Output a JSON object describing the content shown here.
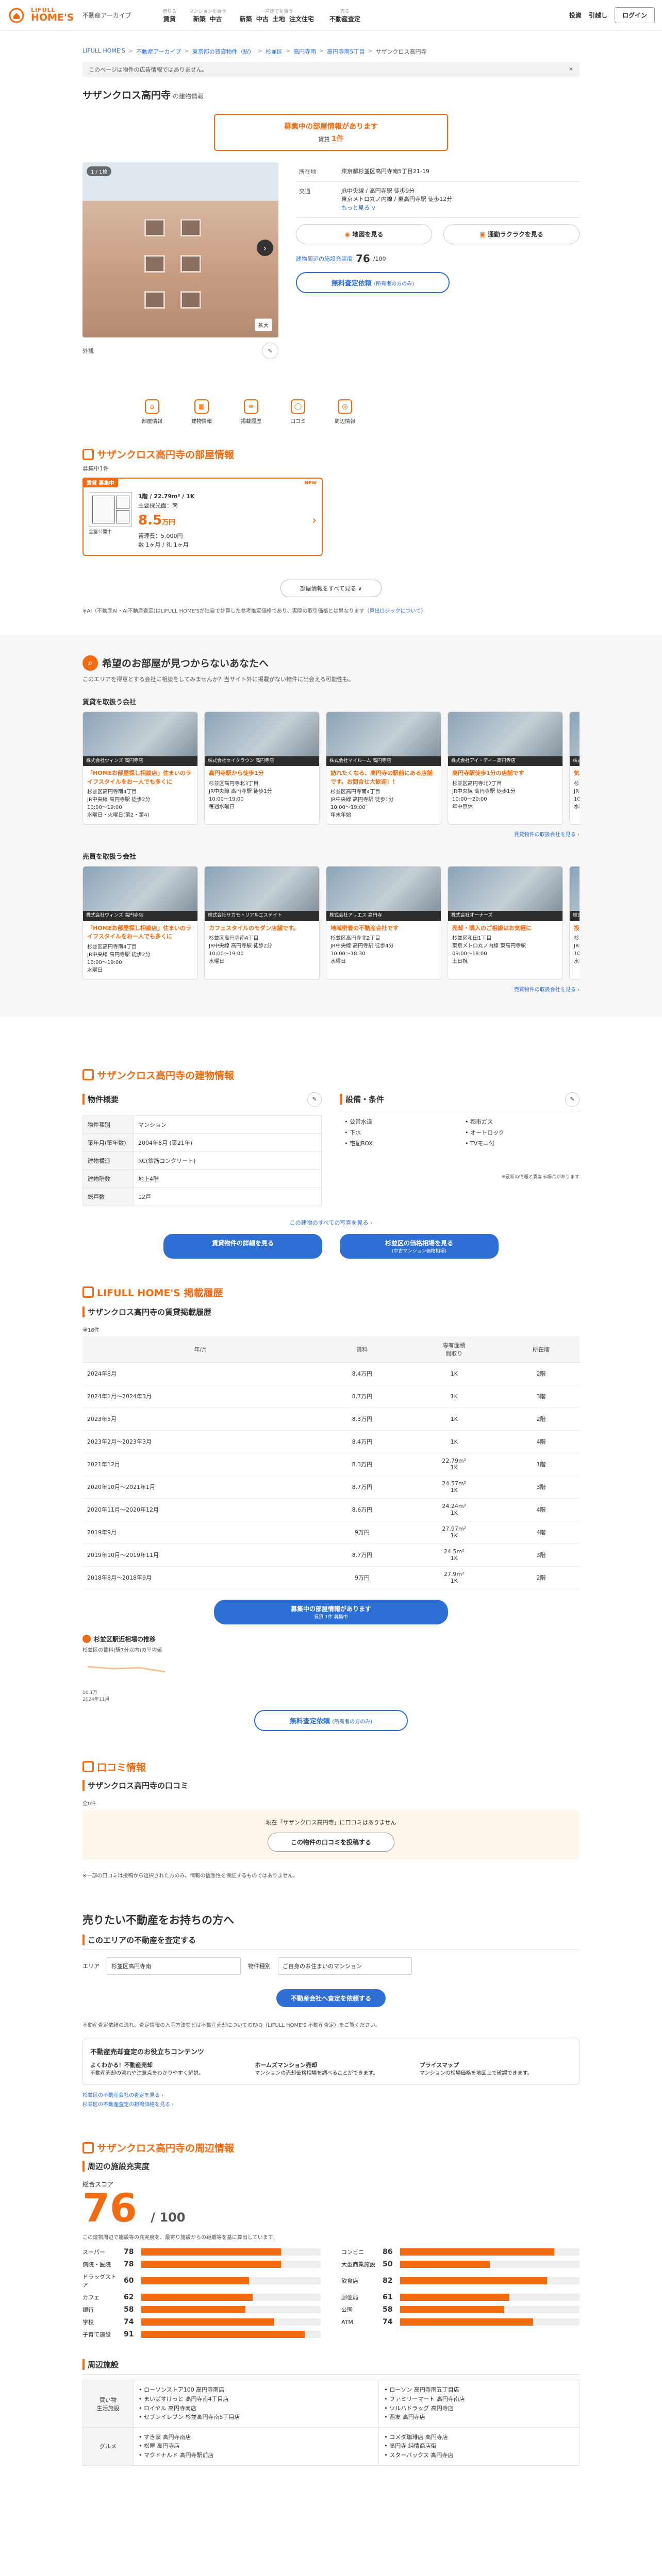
{
  "header": {
    "logo_top": "LIFULL",
    "logo_bottom": "HOME'S",
    "sub": "不動産アーカイブ",
    "nav": [
      {
        "cap": "借りる",
        "links": [
          "賃貸"
        ]
      },
      {
        "cap": "マンションを買う",
        "links": [
          "新築",
          "中古"
        ]
      },
      {
        "cap": "一戸建てを買う",
        "links": [
          "新築",
          "中古",
          "土地",
          "注文住宅"
        ]
      },
      {
        "cap": "売る",
        "links": [
          "不動産査定"
        ]
      }
    ],
    "right": [
      "投資",
      "引越し"
    ],
    "login": "ログイン"
  },
  "breadcrumb": [
    "LIFULL HOME'S",
    "不動産アーカイブ",
    "東京都の賃貸物件（駅）",
    "杉並区",
    "高円寺南",
    "高円寺南5丁目",
    "サザンクロス高円寺"
  ],
  "notice": {
    "text": "このページは物件の広告情報ではありません。",
    "close": "×"
  },
  "building": {
    "name": "サザンクロス高円寺",
    "suffix": "の建物情報"
  },
  "vacancy": {
    "title": "募集中の部屋情報があります",
    "sub_pre": "賃貸",
    "count": "1件"
  },
  "gallery": {
    "count": "1 / 1枚",
    "zoom": "拡大",
    "caption": "外観"
  },
  "info_rows": [
    {
      "k": "所在地",
      "v": "東京都杉並区高円寺南5丁目21-19"
    },
    {
      "k": "交通",
      "v": "JR中央線 / 高円寺駅 徒歩9分",
      "v2": "東京メトロ丸ノ内線 / 東高円寺駅 徒歩12分",
      "link": "もっと見る ∨"
    }
  ],
  "btns": {
    "map": "地図を見る",
    "route": "通勤ラクラクを見る"
  },
  "score": {
    "label": "建物周辺の施設充実度",
    "value": "76",
    "unit": "/100"
  },
  "appraisal": {
    "label": "無料査定依頼",
    "note": "(所有者の方のみ)"
  },
  "icons": [
    {
      "name": "部屋情報",
      "icon": "⌂"
    },
    {
      "name": "建物情報",
      "icon": "▦"
    },
    {
      "name": "掲載履歴",
      "icon": "≡"
    },
    {
      "name": "口コミ",
      "icon": "◯"
    },
    {
      "name": "周辺情報",
      "icon": "◎"
    }
  ],
  "rooms": {
    "title": "サザンクロス高円寺の部屋情報",
    "sub": "募集中1件",
    "card": {
      "tag": "賃貸 募集中",
      "new": "NEW",
      "floor": "1階",
      "layout": "1階 / 22.79m² / 1K",
      "dir": "主要採光面：南",
      "price": "8.5",
      "unit": "万円",
      "mgmt": "管理費：5,000円",
      "deposit": "敷 1ヶ月",
      "key": "礼 1ヶ月",
      "plan_note": "全室公開中"
    },
    "more": "部屋情報をすべて見る ∨",
    "fine": "※AI（不動産AI・AI不動産査定)はLIFULL HOME'Sが独自で計算した参考推定価格であり、実際の取引価格とは異なります（",
    "fine_link": "算出ロジックについて",
    "fine_end": "）"
  },
  "hope": {
    "title": "希望のお部屋が見つからないあなたへ",
    "sub": "このエリアを得意とする会社に相談をしてみませんか？当サイト外に掲載がない物件に出会える可能性も。",
    "rent_h": "賃貸を取扱う会社",
    "rent": [
      {
        "nm": "株式会社ウィンズ 高円寺店",
        "hl": "「HOMEお部屋探し相談店」住まいのライフスタイルをお一人でも多くに",
        "addr": "杉並区高円寺南4丁目",
        "st": "JR中央線 高円寺駅 徒歩2分",
        "time": "10:00～19:00",
        "off": "水曜日・火曜日(第2・第4)"
      },
      {
        "nm": "株式会社セイクラウン 高円寺店",
        "hl": "高円寺駅から徒歩1分",
        "addr": "杉並区高円寺北3丁目",
        "st": "JR中央線 高円寺駅 徒歩1分",
        "time": "10:00～19:00",
        "off": "毎週水曜日"
      },
      {
        "nm": "株式会社マイルーム 高円寺店",
        "hl": "訪れたくなる、高円寺の駅前にある店舗です。お問合せ大歓迎！！",
        "addr": "杉並区高円寺南4丁目",
        "st": "JR中央線 高円寺駅 徒歩1分",
        "time": "10:00～19:00",
        "off": "年末年始"
      },
      {
        "nm": "株式会社アイ・ディー高円寺店",
        "hl": "高円寺駅徒歩1分の店舗です",
        "addr": "杉並区高円寺北2丁目",
        "st": "JR中央線 高円寺駅 徒歩1分",
        "time": "10:00～20:00",
        "off": "年中無休"
      },
      {
        "nm": "株式会社アップル",
        "hl": "気軽にご相談ください",
        "addr": "杉並区高円寺南4丁目",
        "st": "JR中央線 高円寺駅",
        "time": "10:00～19:00",
        "off": "水曜日"
      }
    ],
    "rent_more": "賃貸物件の取扱会社を見る ›",
    "sale_h": "売買を取扱う会社",
    "sale": [
      {
        "nm": "株式会社ウィンズ 高円寺店",
        "hl": "「HOMEお部屋探し相談店」住まいのライフスタイルをお一人でも多くに",
        "addr": "杉並区高円寺南4丁目",
        "st": "JR中央線 高円寺駅 徒歩2分",
        "time": "10:00～19:00",
        "off": "水曜日"
      },
      {
        "nm": "株式会社サカモトリアルエステイト",
        "hl": "カフェスタイルのモダン店舗です。",
        "addr": "杉並区高円寺南4丁目",
        "st": "JR中央線 高円寺駅 徒歩2分",
        "time": "10:00～19:00",
        "off": "水曜日"
      },
      {
        "nm": "株式会社アリエス 高円寺",
        "hl": "地域密着の不動産会社です",
        "addr": "杉並区高円寺北2丁目",
        "st": "JR中央線 高円寺駅 徒歩4分",
        "time": "10:00～18:30",
        "off": "水曜日"
      },
      {
        "nm": "株式会社オーナーズ",
        "hl": "売却・購入のご相談はお気軽に",
        "addr": "杉並区和田1丁目",
        "st": "東京メトロ丸ノ内線 東高円寺駅",
        "time": "09:00～18:00",
        "off": "土日祝"
      },
      {
        "nm": "株式会社ハウスメイト",
        "hl": "投資用物件もお任せください",
        "addr": "杉並区高円寺南3丁目",
        "st": "JR中央線 高円寺駅",
        "time": "10:00～19:00",
        "off": "水曜日"
      }
    ],
    "sale_more": "売買物件の取扱会社を見る ›"
  },
  "bldg": {
    "title": "サザンクロス高円寺の建物情報",
    "ov_h": "物件概要",
    "ov": [
      {
        "k": "物件種別",
        "v": "マンション"
      },
      {
        "k": "築年月(築年数)",
        "v": "2004年8月 (築21年)"
      },
      {
        "k": "建物構造",
        "v": "RC(鉄筋コンクリート)"
      },
      {
        "k": "建物階数",
        "v": "地上4階"
      },
      {
        "k": "総戸数",
        "v": "12戸"
      }
    ],
    "eq_h": "設備・条件",
    "eq": [
      "公営水道",
      "都市ガス",
      "下水",
      "オートロック",
      "宅配BOX",
      "TVモニ付"
    ],
    "eq_note": "※最新の情報と異なる場合があります",
    "more_link": "この建物のすべての写真を見る ›",
    "b1": "賃貸物件の詳細を見る",
    "b2": "杉並区の価格相場を見る",
    "b2s": "(中古マンション価格相場)"
  },
  "history": {
    "title": "LIFULL HOME'S 掲載履歴",
    "sub": "サザンクロス高円寺の賃貸掲載履歴",
    "cap": "全18件",
    "cols": [
      "年/月",
      "賃料",
      "専有面積\n間取り",
      "所在階"
    ],
    "rows": [
      [
        "2024年8月",
        "8.4万円",
        "1K",
        "2階"
      ],
      [
        "2024年1月〜2024年3月",
        "8.7万円",
        "1K",
        "3階"
      ],
      [
        "2023年5月",
        "8.3万円",
        "1K",
        "2階"
      ],
      [
        "2023年2月〜2023年3月",
        "8.4万円",
        "1K",
        "4階"
      ],
      [
        "2021年12月",
        "8.3万円",
        "22.79m²\n1K",
        "1階"
      ],
      [
        "2020年10月〜2021年1月",
        "8.7万円",
        "24.57m²\n1K",
        "3階"
      ],
      [
        "2020年11月〜2020年12月",
        "8.6万円",
        "24.24m²\n1K",
        "4階"
      ],
      [
        "2019年9月",
        "9万円",
        "27.97m²\n1K",
        "4階"
      ],
      [
        "2019年10月〜2019年11月",
        "8.7万円",
        "24.5m²\n1K",
        "3階"
      ],
      [
        "2018年8月〜2018年9月",
        "9万円",
        "27.9m²\n1K",
        "2階"
      ]
    ],
    "btn": "募集中の部屋情報があります",
    "btn_sub": "賃貸 1件 募集中",
    "trend": "杉並区駅近相場の推移",
    "trend_sub": "杉並区の賃料(駅7分以内)の平均値",
    "trend_year": "2024年11月",
    "trend_val": "10.1万",
    "appraisal": "無料査定依頼",
    "appraisal_note": "(所有者の方のみ)"
  },
  "review": {
    "title": "口コミ情報",
    "sub": "サザンクロス高円寺の口コミ",
    "cap": "全0件",
    "empty": "現在「サザンクロス高円寺」に口コミはありません",
    "btn": "この物件の口コミを投稿する",
    "note": "※一部の口コミは投稿から選択された方のみ。情報の信憑性を保証するものではありません。"
  },
  "sell": {
    "title": "売りたい不動産をお持ちの方へ",
    "sub": "このエリアの不動産を査定する",
    "area_label": "エリア",
    "area": "杉並区高円寺南",
    "type_label": "物件種別",
    "type": "ご自身のお住まいのマンション",
    "btn": "不動産会社へ査定を依頼する",
    "note": "不動産査定依頼の流れ、査定情報の入手方法などは不動産売却についてのFAQ（LIFULL HOME'S 不動産査定）をご覧ください。",
    "cont_h": "不動産売却査定のお役立ちコンテンツ",
    "cont": [
      {
        "h": "よくわかる！不動産売却",
        "t": "不動産売却の流れや注意点をわかりやすく解説。"
      },
      {
        "h": "ホームズマンション売却",
        "t": "マンションの売却価格相場を調べることができます。"
      },
      {
        "h": "プライスマップ",
        "t": "マンションの相場価格を地図上で確認できます。"
      }
    ],
    "links": [
      "杉並区の不動産会社の査定を見る ›",
      "杉並区の不動産査定の相場価格を見る ›"
    ]
  },
  "env": {
    "title": "サザンクロス高円寺の周辺情報",
    "sub": "周辺の施設充実度",
    "label": "総合スコア",
    "score": "76",
    "max": "/ 100",
    "note": "この建物周辺で施設等の充実度を、最寄り施設からの距離等を基に算出しています。",
    "items": [
      {
        "n": "スーパー",
        "v": 78
      },
      {
        "n": "コンビニ",
        "v": 86
      },
      {
        "n": "病院・医院",
        "v": 78
      },
      {
        "n": "大型商業施設",
        "v": 50
      },
      {
        "n": "ドラッグストア",
        "v": 60
      },
      {
        "n": "飲食店",
        "v": 82
      },
      {
        "n": "カフェ",
        "v": 62
      },
      {
        "n": "郵便局",
        "v": 61
      },
      {
        "n": "銀行",
        "v": 58
      },
      {
        "n": "公園",
        "v": 58
      },
      {
        "n": "学校",
        "v": 74
      },
      {
        "n": "ATM",
        "v": 74
      },
      {
        "n": "子育て施設",
        "v": 91
      }
    ]
  },
  "near": {
    "title": "周辺施設",
    "rows": [
      {
        "k": "買い物\n生活施設",
        "a": "• ローソンストア100 高円寺南店\n• まいばすけっと 高円寺南4丁目店\n• ロイヤル 高円寺南店\n• セブンイレブン 杉並高円寺南5丁目店",
        "b": "• ローソン 高円寺南五丁目店\n• ファミリーマート 高円寺南店\n• ツルハドラッグ 高円寺店\n• 西友 高円寺店"
      },
      {
        "k": "グルメ",
        "a": "• すき家 高円寺南店\n• 松屋 高円寺店\n• マクドナルド 高円寺駅前店",
        "b": "• コメダ珈琲店 高円寺店\n• 高円寺 純情商店街\n• スターバックス 高円寺店"
      }
    ]
  }
}
